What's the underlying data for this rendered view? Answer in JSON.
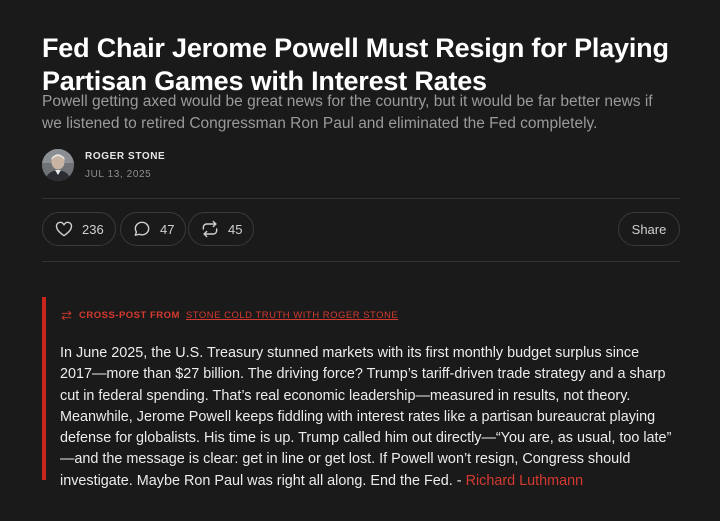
{
  "post": {
    "title_lines": [
      "Fed Chair Jerome Powell Must Resign for Playing",
      "Partisan Games with Interest Rates"
    ],
    "subtitle_lines": [
      "Powell getting axed would be great news for the country, but it would be far better news if",
      "we listened to retired Congressman Ron Paul and eliminated the Fed completely."
    ],
    "author": "ROGER STONE",
    "date": "JUL 13, 2025"
  },
  "actions": {
    "likes": "236",
    "comments": "47",
    "restacks": "45",
    "share_label": "Share"
  },
  "crosspost": {
    "prefix": "CROSS-POST FROM",
    "source": "STONE COLD TRUTH WITH ROGER STONE"
  },
  "body": {
    "lines": [
      "In June 2025, the U.S. Treasury stunned markets with its first monthly budget surplus since",
      "2017—more than $27 billion. The driving force? Trump’s tariff-driven trade strategy and a sharp",
      "cut in federal spending. That’s real economic leadership—measured in results, not theory.",
      "Meanwhile, Jerome Powell keeps fiddling with interest rates like a partisan bureaucrat playing",
      "defense for globalists. His time is up. Trump called him out directly—“You are, as usual, too late”",
      "—and the message is clear: get in line or get lost. If Powell won’t resign, Congress should"
    ],
    "last_line_text": "investigate. Maybe Ron Paul was right all along. End the Fed. - ",
    "link_text": "Richard Luthmann"
  },
  "icons": {
    "like": "heart-icon",
    "comment": "comment-bubble-icon",
    "restack": "restack-arrows-icon",
    "crosspost": "crosspost-arrows-icon"
  },
  "colors": {
    "background": "#1a1a1a",
    "accent": "#d43a2f",
    "muted_text": "#9a9a9a"
  }
}
